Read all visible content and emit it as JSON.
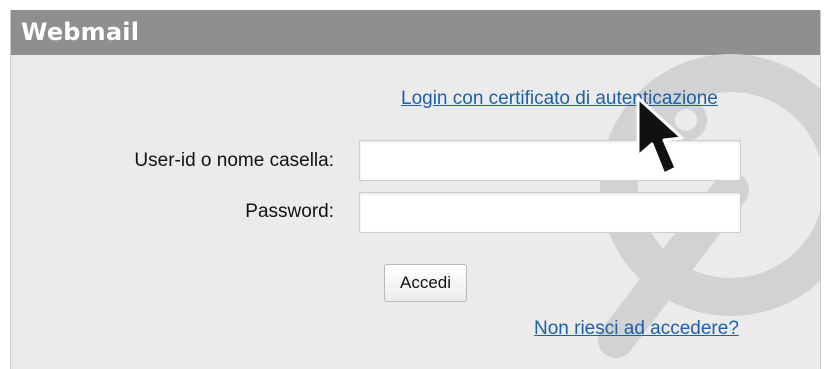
{
  "app": {
    "title": "Webmail"
  },
  "login": {
    "certificate_link": "Login con certificato di autenticazione",
    "username_label": "User-id o nome casella:",
    "username_value": "",
    "password_label": "Password:",
    "password_value": "",
    "submit_label": "Accedi",
    "help_link": "Non riesci ad accedere?"
  },
  "colors": {
    "header_bg": "#8f8f8f",
    "panel_bg": "#ebebeb",
    "link": "#1f5fa8",
    "watermark": "#d2d2d2"
  },
  "icons": {
    "watermark": "padlock-icon",
    "cursor": "mouse-pointer-icon"
  }
}
